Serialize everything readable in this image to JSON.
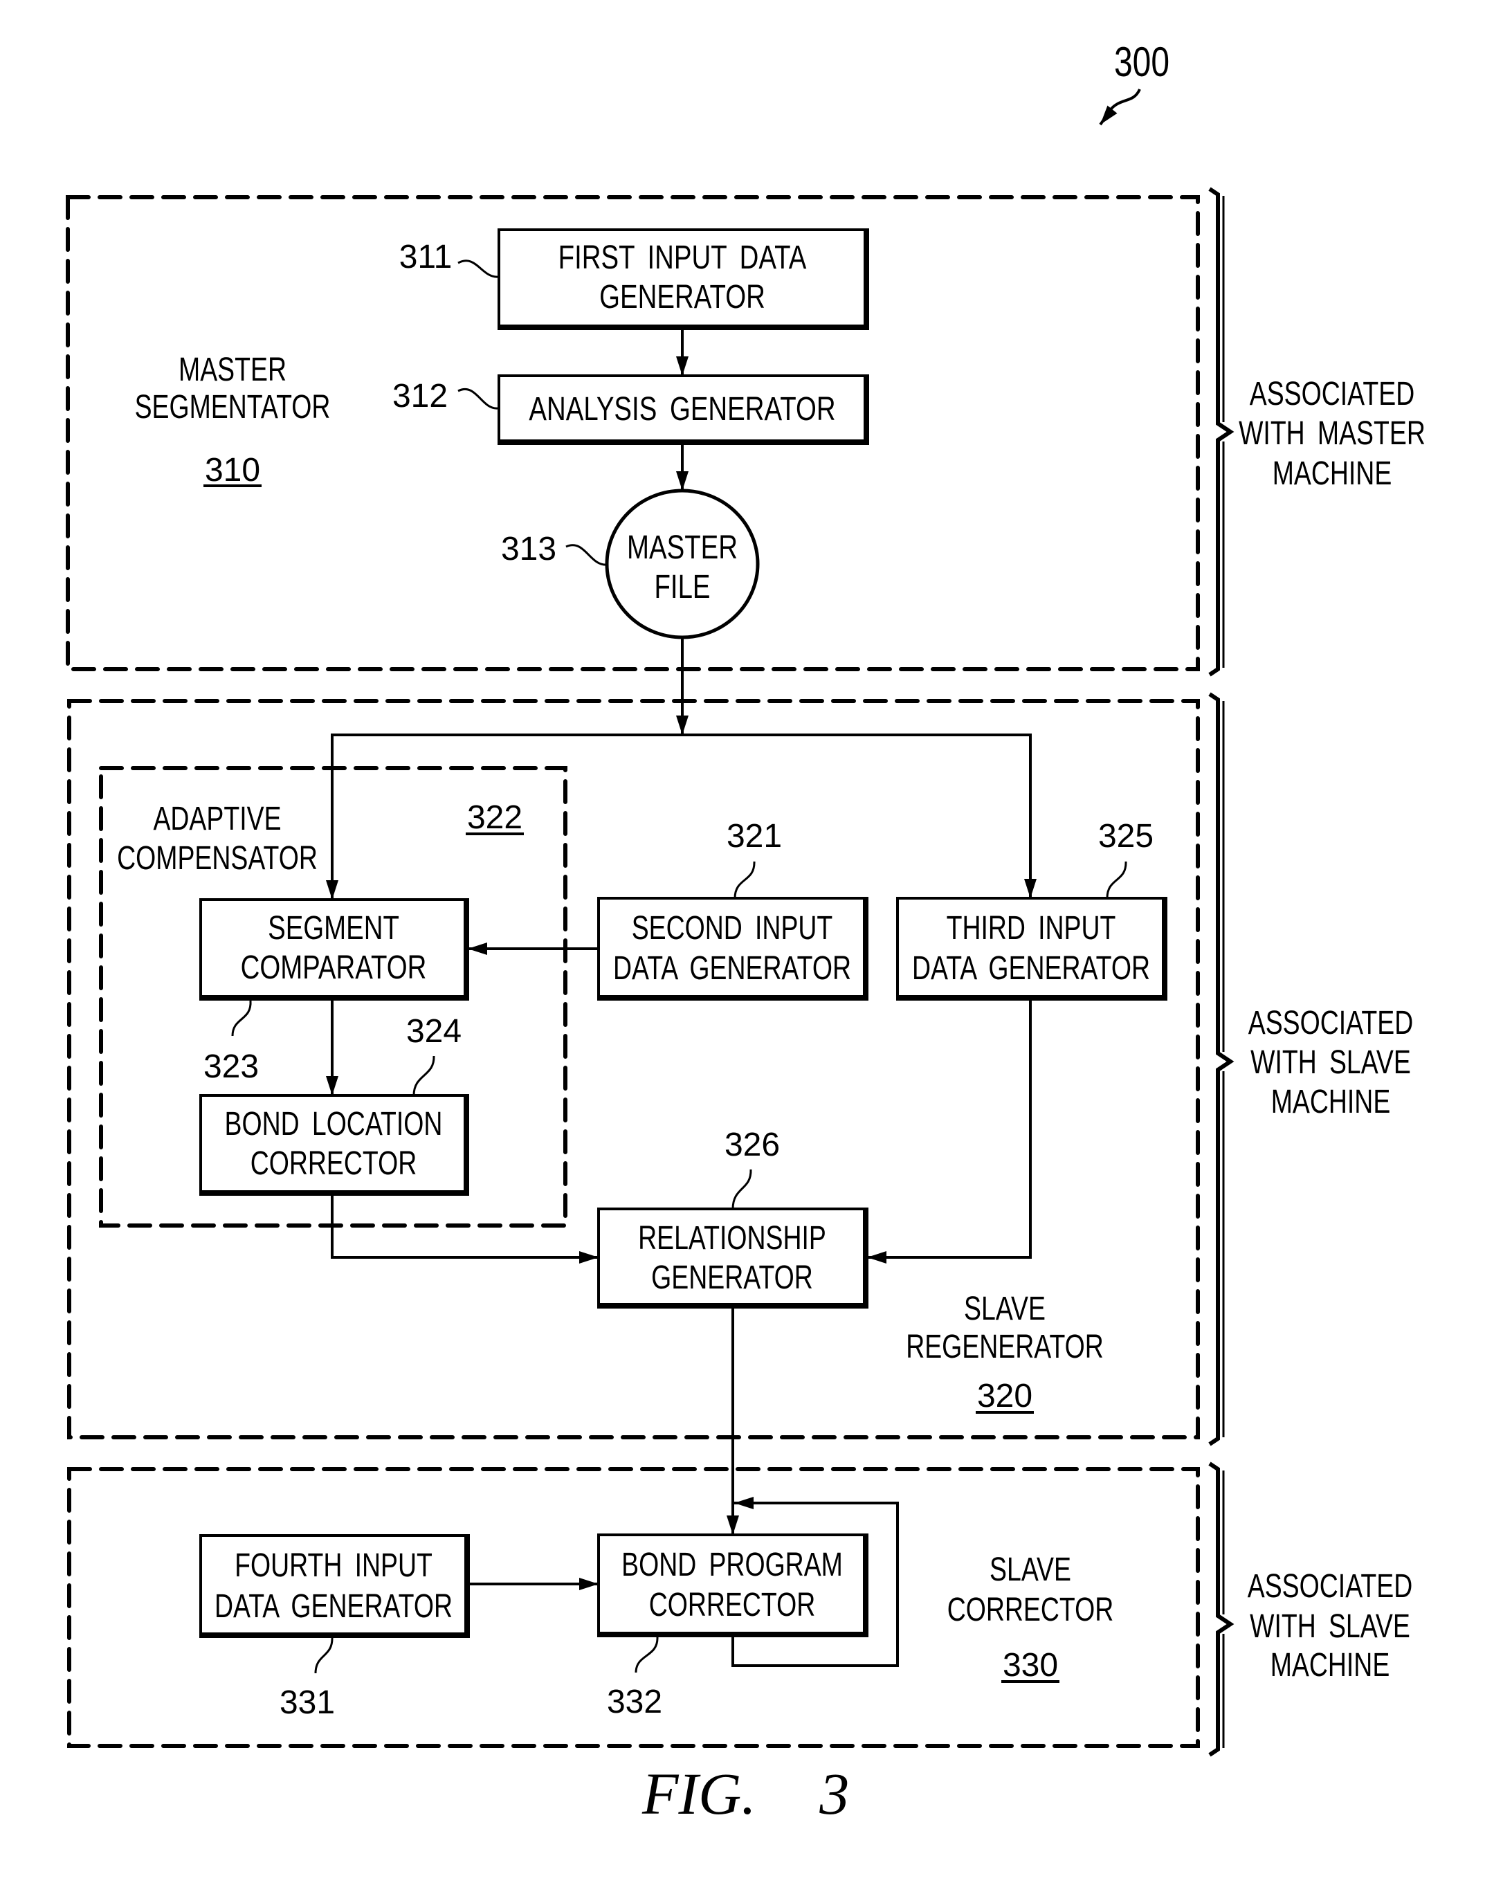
{
  "colors": {
    "ink": "#000000",
    "paper": "#ffffff"
  },
  "figure": {
    "reference": "300",
    "caption": "FIG. 3"
  },
  "regions": {
    "master_segmentator": {
      "title": [
        "MASTER",
        "SEGMENTATOR"
      ],
      "ref": "310",
      "association": [
        "ASSOCIATED",
        "WITH MASTER",
        "MACHINE"
      ]
    },
    "slave_regenerator": {
      "title": [
        "SLAVE",
        "REGENERATOR"
      ],
      "ref": "320",
      "association": [
        "ASSOCIATED",
        "WITH SLAVE",
        "MACHINE"
      ]
    },
    "adaptive_compensator": {
      "title": [
        "ADAPTIVE",
        "COMPENSATOR"
      ],
      "ref": "322"
    },
    "slave_corrector": {
      "title": [
        "SLAVE",
        "CORRECTOR"
      ],
      "ref": "330",
      "association": [
        "ASSOCIATED",
        "WITH SLAVE",
        "MACHINE"
      ]
    }
  },
  "blocks": {
    "first_input": {
      "ref": "311",
      "lines": [
        "FIRST INPUT DATA",
        "GENERATOR"
      ]
    },
    "analysis": {
      "ref": "312",
      "lines": [
        "ANALYSIS GENERATOR"
      ]
    },
    "master_file": {
      "ref": "313",
      "lines": [
        "MASTER",
        "FILE"
      ],
      "shape": "circle"
    },
    "second_input": {
      "ref": "321",
      "lines": [
        "SECOND INPUT",
        "DATA GENERATOR"
      ]
    },
    "segment_comparator": {
      "ref": "323",
      "lines": [
        "SEGMENT",
        "COMPARATOR"
      ]
    },
    "bond_location": {
      "ref": "324",
      "lines": [
        "BOND LOCATION",
        "CORRECTOR"
      ]
    },
    "third_input": {
      "ref": "325",
      "lines": [
        "THIRD INPUT",
        "DATA GENERATOR"
      ]
    },
    "relationship": {
      "ref": "326",
      "lines": [
        "RELATIONSHIP",
        "GENERATOR"
      ]
    },
    "fourth_input": {
      "ref": "331",
      "lines": [
        "FOURTH INPUT",
        "DATA GENERATOR"
      ]
    },
    "bond_program": {
      "ref": "332",
      "lines": [
        "BOND PROGRAM",
        "CORRECTOR"
      ]
    }
  },
  "connections": [
    {
      "from": "311",
      "to": "312"
    },
    {
      "from": "312",
      "to": "313"
    },
    {
      "from": "313",
      "to": "323"
    },
    {
      "from": "313",
      "to": "325"
    },
    {
      "from": "321",
      "to": "323"
    },
    {
      "from": "323",
      "to": "324"
    },
    {
      "from": "324",
      "to": "326"
    },
    {
      "from": "325",
      "to": "326"
    },
    {
      "from": "326",
      "to": "332"
    },
    {
      "from": "331",
      "to": "332"
    },
    {
      "from": "332",
      "to": "332"
    }
  ]
}
